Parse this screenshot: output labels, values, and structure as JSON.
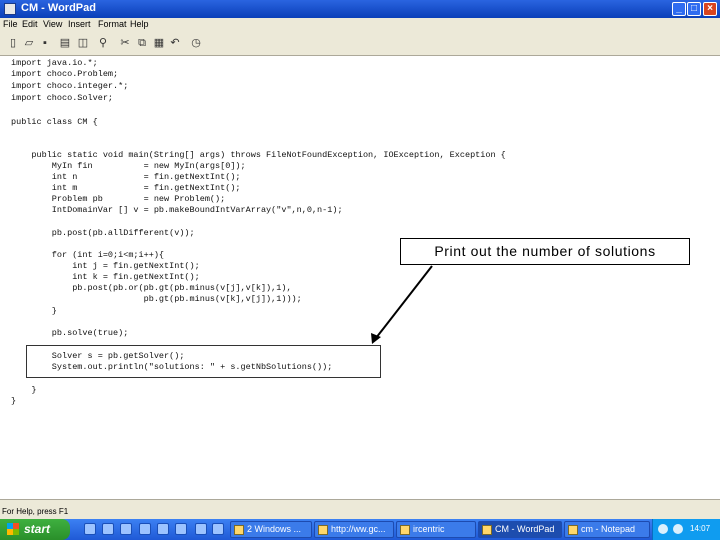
{
  "window": {
    "title": "CM - WordPad",
    "minimize_glyph": "_",
    "maximize_glyph": "□",
    "close_glyph": "×"
  },
  "menu": [
    "File",
    "Edit",
    "View",
    "Insert",
    "Format",
    "Help"
  ],
  "toolbar": [
    "new-icon",
    "open-icon",
    "save-icon",
    "print-icon",
    "print-preview-icon",
    "find-icon",
    "cut-icon",
    "copy-icon",
    "paste-icon",
    "undo-icon",
    "date-time-icon"
  ],
  "code": [
    "import java.io.*;",
    "import choco.Problem;",
    "import choco.integer.*;",
    "import choco.Solver;",
    "",
    "public class CM {",
    "",
    "    public static void main(String[] args) throws FileNotFoundException, IOException, Exception {",
    "        MyIn fin          = new MyIn(args[0]);",
    "        int n             = fin.getNextInt();",
    "        int m             = fin.getNextInt();",
    "        Problem pb        = new Problem();",
    "        IntDomainVar [] v = pb.makeBoundIntVarArray(\"v\",n,0,n-1);",
    "",
    "        pb.post(pb.allDifferent(v));",
    "",
    "        for (int i=0;i<m;i++){",
    "            int j = fin.getNextInt();",
    "            int k = fin.getNextInt();",
    "            pb.post(pb.or(pb.gt(pb.minus(v[j],v[k]),1),",
    "                          pb.gt(pb.minus(v[k],v[j]),1)));",
    "        }",
    "",
    "        pb.solve(true);",
    "",
    "        Solver s = pb.getSolver();",
    "        System.out.println(\"solutions: \" + s.getNbSolutions());",
    "    }",
    "}"
  ],
  "callout": {
    "text": "Print out the number of solutions"
  },
  "status": "For Help, press F1",
  "taskbar": {
    "start_label": "start",
    "tasks": [
      "2 Windows ...",
      "http://ww.gc...",
      "ircentric",
      "CM - WordPad",
      "cm - Notepad"
    ],
    "clock": "14:07"
  }
}
